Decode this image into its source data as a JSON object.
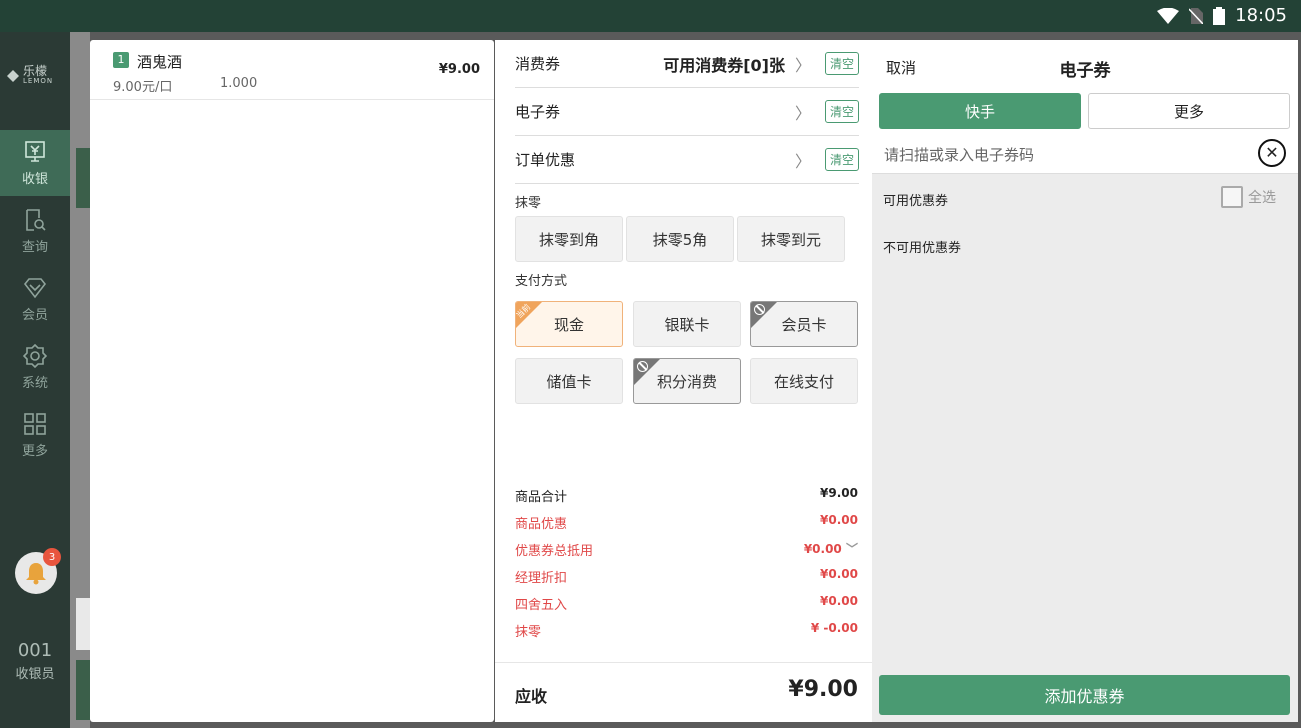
{
  "status_bar": {
    "time": "18:05"
  },
  "logo": {
    "name": "乐檬",
    "sub": "LEMON"
  },
  "nav": [
    {
      "label": "收银",
      "icon": "cashier-icon"
    },
    {
      "label": "查询",
      "icon": "query-icon"
    },
    {
      "label": "会员",
      "icon": "member-icon"
    },
    {
      "label": "系统",
      "icon": "settings-icon"
    },
    {
      "label": "更多",
      "icon": "more-icon"
    }
  ],
  "notification": {
    "count": "3"
  },
  "cashier": {
    "id": "001",
    "label": "收银员"
  },
  "order": {
    "items": [
      {
        "index": "1",
        "name": "酒鬼酒",
        "unit_price": "9.00元/口",
        "quantity": "1.000",
        "price": "¥9.00"
      }
    ]
  },
  "payment": {
    "rows": [
      {
        "label": "消费券",
        "value": "可用消费券[0]张",
        "clear": "清空"
      },
      {
        "label": "电子券",
        "value": "",
        "clear": "清空"
      },
      {
        "label": "订单优惠",
        "value": "",
        "clear": "清空"
      }
    ],
    "rounding_label": "抹零",
    "rounding_options": [
      "抹零到角",
      "抹零5角",
      "抹零到元"
    ],
    "method_label": "支付方式",
    "methods": [
      {
        "label": "现金",
        "state": "selected",
        "tag": "当前"
      },
      {
        "label": "银联卡",
        "state": "normal"
      },
      {
        "label": "会员卡",
        "state": "disabled"
      },
      {
        "label": "储值卡",
        "state": "normal"
      },
      {
        "label": "积分消费",
        "state": "disabled"
      },
      {
        "label": "在线支付",
        "state": "normal"
      }
    ],
    "summary": [
      {
        "label": "商品合计",
        "value": "¥9.00",
        "color": "#222222"
      },
      {
        "label": "商品优惠",
        "value": "¥0.00",
        "color": "#e04848"
      },
      {
        "label": "优惠券总抵用",
        "value": "¥0.00",
        "color": "#e04848"
      },
      {
        "label": "经理折扣",
        "value": "¥0.00",
        "color": "#e04848"
      },
      {
        "label": "四舍五入",
        "value": "¥0.00",
        "color": "#e04848"
      },
      {
        "label": "抹零",
        "value": "¥ -0.00",
        "color": "#e04848"
      }
    ],
    "total_label": "应收",
    "total_value": "¥9.00"
  },
  "coupon": {
    "cancel": "取消",
    "title": "电子券",
    "tabs": [
      "快手",
      "更多"
    ],
    "input_placeholder": "请扫描或录入电子券码",
    "available_label": "可用优惠券",
    "select_all": "全选",
    "unavailable_label": "不可用优惠券",
    "add_button": "添加优惠券"
  },
  "colors": {
    "accent": "#4a9a72",
    "alert": "#e04848",
    "status_bar": "#234236"
  }
}
